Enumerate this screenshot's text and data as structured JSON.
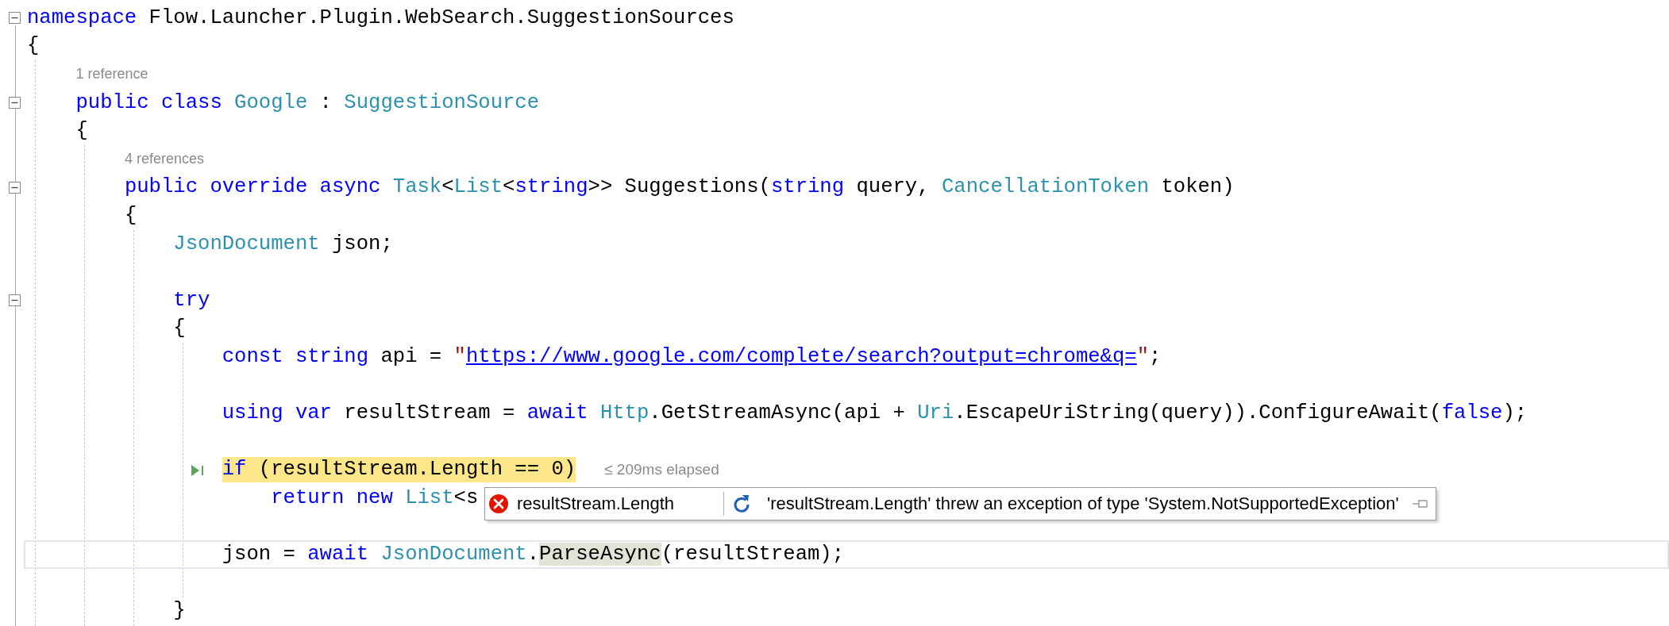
{
  "editor": {
    "lines": [
      {
        "kind": "code",
        "fold": true,
        "tokens": [
          {
            "kind": "keyword",
            "s": "namespace"
          },
          {
            "kind": "plain",
            "s": " Flow.Launcher.Plugin.WebSearch.SuggestionSources"
          }
        ]
      },
      {
        "kind": "code",
        "tokens": [
          {
            "kind": "plain",
            "s": "{"
          }
        ],
        "children": [
          {
            "kind": "lens",
            "text": "1 reference"
          },
          {
            "kind": "code",
            "fold": true,
            "tokens": [
              {
                "kind": "keyword",
                "s": "public class "
              },
              {
                "kind": "type",
                "s": "Google"
              },
              {
                "kind": "plain",
                "s": " : "
              },
              {
                "kind": "type",
                "s": "SuggestionSource"
              }
            ]
          },
          {
            "kind": "code",
            "tokens": [
              {
                "kind": "plain",
                "s": "{"
              }
            ],
            "children": [
              {
                "kind": "lens",
                "text": "4 references"
              },
              {
                "kind": "code",
                "fold": true,
                "tokens": [
                  {
                    "kind": "keyword",
                    "s": "public override async "
                  },
                  {
                    "kind": "type",
                    "s": "Task"
                  },
                  {
                    "kind": "plain",
                    "s": "<"
                  },
                  {
                    "kind": "type",
                    "s": "List"
                  },
                  {
                    "kind": "plain",
                    "s": "<"
                  },
                  {
                    "kind": "keyword",
                    "s": "string"
                  },
                  {
                    "kind": "plain",
                    "s": ">> Suggestions("
                  },
                  {
                    "kind": "keyword",
                    "s": "string"
                  },
                  {
                    "kind": "plain",
                    "s": " query, "
                  },
                  {
                    "kind": "type",
                    "s": "CancellationToken"
                  },
                  {
                    "kind": "plain",
                    "s": " token)"
                  }
                ]
              },
              {
                "kind": "code",
                "tokens": [
                  {
                    "kind": "plain",
                    "s": "{"
                  }
                ],
                "children": [
                  {
                    "kind": "code",
                    "tokens": [
                      {
                        "kind": "type",
                        "s": "JsonDocument"
                      },
                      {
                        "kind": "plain",
                        "s": " json;"
                      }
                    ]
                  },
                  {
                    "kind": "blank"
                  },
                  {
                    "kind": "code",
                    "fold": true,
                    "tokens": [
                      {
                        "kind": "keyword",
                        "s": "try"
                      }
                    ]
                  },
                  {
                    "kind": "code",
                    "tokens": [
                      {
                        "kind": "plain",
                        "s": "{"
                      }
                    ],
                    "children": [
                      {
                        "kind": "code",
                        "tokens": [
                          {
                            "kind": "keyword",
                            "s": "const string"
                          },
                          {
                            "kind": "plain",
                            "s": " api = "
                          },
                          {
                            "kind": "string",
                            "s": "\""
                          },
                          {
                            "kind": "link",
                            "s": "https://www.google.com/complete/search?output=chrome&q="
                          },
                          {
                            "kind": "string",
                            "s": "\""
                          },
                          {
                            "kind": "plain",
                            "s": ";"
                          }
                        ]
                      },
                      {
                        "kind": "blank"
                      },
                      {
                        "kind": "code",
                        "tokens": [
                          {
                            "kind": "keyword",
                            "s": "using var"
                          },
                          {
                            "kind": "plain",
                            "s": " resultStream = "
                          },
                          {
                            "kind": "keyword",
                            "s": "await "
                          },
                          {
                            "kind": "type",
                            "s": "Http"
                          },
                          {
                            "kind": "plain",
                            "s": ".GetStreamAsync(api + "
                          },
                          {
                            "kind": "type",
                            "s": "Uri"
                          },
                          {
                            "kind": "plain",
                            "s": ".EscapeUriString(query)).ConfigureAwait("
                          },
                          {
                            "kind": "keyword",
                            "s": "false"
                          },
                          {
                            "kind": "plain",
                            "s": ");"
                          }
                        ]
                      },
                      {
                        "kind": "blank"
                      },
                      {
                        "kind": "code",
                        "execution": true,
                        "elapsed": "≤ 209ms elapsed",
                        "tokens": [
                          {
                            "kind": "keyword",
                            "s": "if"
                          },
                          {
                            "kind": "plain",
                            "s": " (resultStream.Length == 0)"
                          }
                        ],
                        "children": [
                          {
                            "kind": "code",
                            "tokens": [
                              {
                                "kind": "keyword",
                                "s": "return new "
                              },
                              {
                                "kind": "type",
                                "s": "List"
                              },
                              {
                                "kind": "plain",
                                "s": "<s"
                              }
                            ],
                            "datatip": {
                              "name": "resultStream.Length",
                              "value": "'resultStream.Length' threw an exception of type 'System.NotSupportedException'",
                              "error": true
                            }
                          }
                        ]
                      },
                      {
                        "kind": "blank"
                      },
                      {
                        "kind": "code",
                        "current": true,
                        "tokens": [
                          {
                            "kind": "plain",
                            "s": "json = "
                          },
                          {
                            "kind": "keyword",
                            "s": "await "
                          },
                          {
                            "kind": "type",
                            "s": "JsonDocument"
                          },
                          {
                            "kind": "plain",
                            "s": "."
                          },
                          {
                            "kind": "ref",
                            "s": "ParseAsync"
                          },
                          {
                            "kind": "plain",
                            "s": "(resultStream);"
                          }
                        ]
                      },
                      {
                        "kind": "blank"
                      }
                    ]
                  },
                  {
                    "kind": "code",
                    "tokens": [
                      {
                        "kind": "plain",
                        "s": "}"
                      }
                    ]
                  }
                ]
              }
            ]
          }
        ]
      }
    ]
  }
}
